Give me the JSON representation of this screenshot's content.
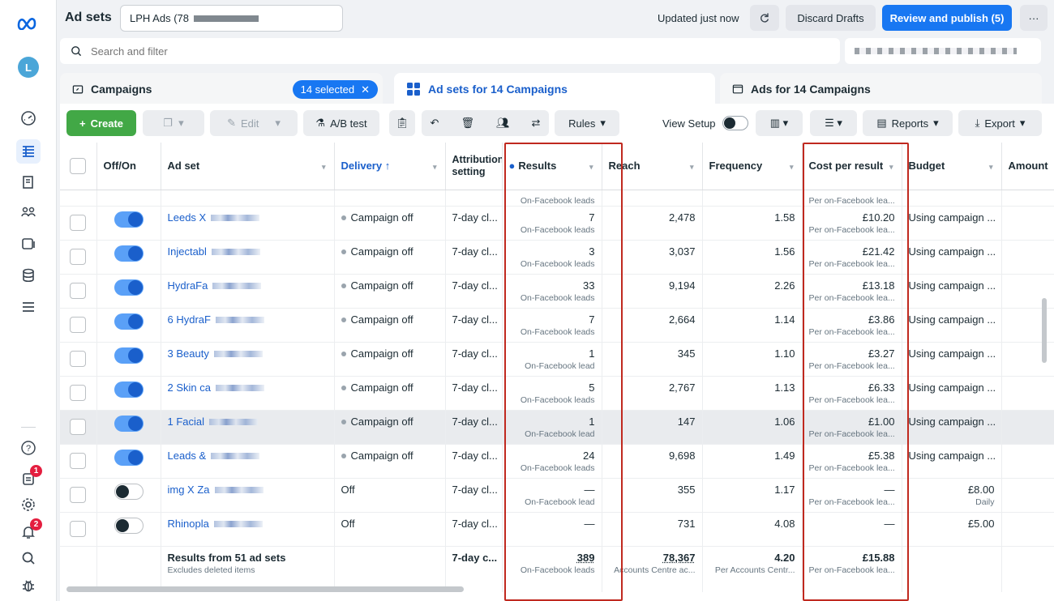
{
  "header": {
    "title": "Ad sets",
    "account": "LPH Ads (78",
    "status": "Updated just now",
    "discard": "Discard Drafts",
    "publish": "Review and publish (5)",
    "more": "···"
  },
  "search": {
    "placeholder": "Search and filter"
  },
  "tabs": {
    "campaigns": "Campaigns",
    "selected": "14 selected",
    "adsets": "Ad sets for 14 Campaigns",
    "ads": "Ads for 14 Campaigns"
  },
  "toolbar": {
    "create": "Create",
    "edit": "Edit",
    "ab": "A/B test",
    "rules": "Rules",
    "view_setup": "View Setup",
    "reports": "Reports",
    "export": "Export"
  },
  "columns": [
    "Off/On",
    "Ad set",
    "Delivery ↑",
    "Attribution setting",
    "Results",
    "Reach",
    "Frequency",
    "Cost per result",
    "Budget",
    "Amount"
  ],
  "partial": {
    "results_sub": "On-Facebook leads",
    "cost_sub": "Per on-Facebook lea..."
  },
  "rows": [
    {
      "on": true,
      "name": "Leeds X",
      "delivery": "Campaign off",
      "attr": "7-day cl...",
      "results": "7",
      "results_sub": "On-Facebook leads",
      "reach": "2,478",
      "freq": "1.58",
      "cost": "£10.20",
      "cost_sub": "Per on-Facebook lea...",
      "budget": "Using campaign ...",
      "hl": false
    },
    {
      "on": true,
      "name": "Injectabl",
      "delivery": "Campaign off",
      "attr": "7-day cl...",
      "results": "3",
      "results_sub": "On-Facebook leads",
      "reach": "3,037",
      "freq": "1.56",
      "cost": "£21.42",
      "cost_sub": "Per on-Facebook lea...",
      "budget": "Using campaign ...",
      "hl": false
    },
    {
      "on": true,
      "name": "HydraFa",
      "delivery": "Campaign off",
      "attr": "7-day cl...",
      "results": "33",
      "results_sub": "On-Facebook leads",
      "reach": "9,194",
      "freq": "2.26",
      "cost": "£13.18",
      "cost_sub": "Per on-Facebook lea...",
      "budget": "Using campaign ...",
      "hl": false
    },
    {
      "on": true,
      "name": "6 HydraF",
      "delivery": "Campaign off",
      "attr": "7-day cl...",
      "results": "7",
      "results_sub": "On-Facebook leads",
      "reach": "2,664",
      "freq": "1.14",
      "cost": "£3.86",
      "cost_sub": "Per on-Facebook lea...",
      "budget": "Using campaign ...",
      "hl": false
    },
    {
      "on": true,
      "name": "3 Beauty",
      "delivery": "Campaign off",
      "attr": "7-day cl...",
      "results": "1",
      "results_sub": "On-Facebook lead",
      "reach": "345",
      "freq": "1.10",
      "cost": "£3.27",
      "cost_sub": "Per on-Facebook lea...",
      "budget": "Using campaign ...",
      "hl": false
    },
    {
      "on": true,
      "name": "2 Skin ca",
      "delivery": "Campaign off",
      "attr": "7-day cl...",
      "results": "5",
      "results_sub": "On-Facebook leads",
      "reach": "2,767",
      "freq": "1.13",
      "cost": "£6.33",
      "cost_sub": "Per on-Facebook lea...",
      "budget": "Using campaign ...",
      "hl": false
    },
    {
      "on": true,
      "name": "1 Facial",
      "delivery": "Campaign off",
      "attr": "7-day cl...",
      "results": "1",
      "results_sub": "On-Facebook lead",
      "reach": "147",
      "freq": "1.06",
      "cost": "£1.00",
      "cost_sub": "Per on-Facebook lea...",
      "budget": "Using campaign ...",
      "hl": true
    },
    {
      "on": true,
      "name": "Leads &",
      "delivery": "Campaign off",
      "attr": "7-day cl...",
      "results": "24",
      "results_sub": "On-Facebook leads",
      "reach": "9,698",
      "freq": "1.49",
      "cost": "£5.38",
      "cost_sub": "Per on-Facebook lea...",
      "budget": "Using campaign ...",
      "hl": false
    },
    {
      "on": false,
      "name": "img X Za",
      "delivery": "Off",
      "attr": "7-day cl...",
      "results": "—",
      "results_sub": "On-Facebook lead",
      "reach": "355",
      "freq": "1.17",
      "cost": "—",
      "cost_sub": "Per on-Facebook lea...",
      "budget": "£8.00",
      "budget_sub": "Daily",
      "hl": false
    },
    {
      "on": false,
      "name": "Rhinopla",
      "delivery": "Off",
      "attr": "7-day cl...",
      "results": "—",
      "results_sub": "",
      "reach": "731",
      "freq": "4.08",
      "cost": "—",
      "cost_sub": "",
      "budget": "£5.00",
      "budget_sub": "",
      "hl": false
    }
  ],
  "footer": {
    "label": "Results from 51 ad sets",
    "sub": "Excludes deleted items",
    "attr": "7-day c...",
    "results": "389",
    "results_sub": "On-Facebook leads",
    "reach": "78,367",
    "reach_sub": "Accounts Centre ac...",
    "freq": "4.20",
    "freq_sub": "Per Accounts Centr...",
    "cost": "£15.88",
    "cost_sub": "Per on-Facebook lea..."
  },
  "colors": {
    "accent": "#1877f2",
    "highlight_box": "#c0291f"
  }
}
